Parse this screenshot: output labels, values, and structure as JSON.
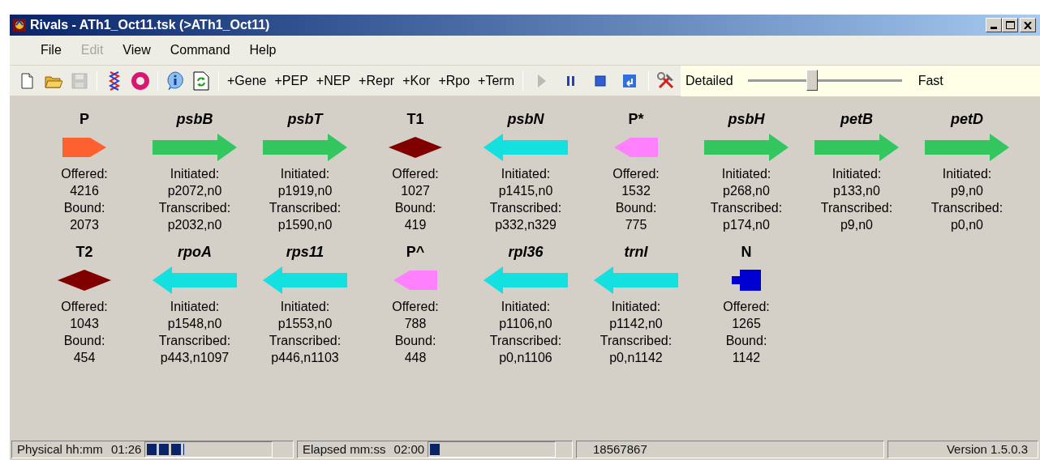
{
  "window": {
    "title": "Rivals - ATh1_Oct11.tsk (>ATh1_Oct11)"
  },
  "menu": [
    {
      "label": "File",
      "disabled": false
    },
    {
      "label": "Edit",
      "disabled": true
    },
    {
      "label": "View",
      "disabled": false
    },
    {
      "label": "Command",
      "disabled": false
    },
    {
      "label": "Help",
      "disabled": false
    }
  ],
  "toolbar": {
    "file_tools": [
      {
        "kind": "new",
        "disabled": false
      },
      {
        "kind": "open",
        "disabled": false
      },
      {
        "kind": "save",
        "disabled": true
      }
    ],
    "add_buttons": [
      "+Gene",
      "+PEP",
      "+NEP",
      "+Repr",
      "+Kor",
      "+Rpo",
      "+Term"
    ],
    "run_tools": [
      {
        "kind": "play",
        "disabled": true
      },
      {
        "kind": "pause",
        "disabled": false
      },
      {
        "kind": "stop",
        "disabled": false
      },
      {
        "kind": "back",
        "disabled": false
      }
    ],
    "speed": {
      "left_label": "Detailed",
      "right_label": "Fast",
      "level": 0.41
    }
  },
  "rows": [
    [
      {
        "name": "P",
        "kind": "promoter-right",
        "color": "#ff6030",
        "lines": [
          "Offered:",
          "4216",
          "Bound:",
          "2073"
        ]
      },
      {
        "name": "psbB",
        "kind": "gene-right",
        "color": "#33c65f",
        "lines": [
          "Initiated:",
          "p2072,n0",
          "Transcribed:",
          "p2032,n0"
        ]
      },
      {
        "name": "psbT",
        "kind": "gene-right",
        "color": "#33c65f",
        "lines": [
          "Initiated:",
          "p1919,n0",
          "Transcribed:",
          "p1590,n0"
        ]
      },
      {
        "name": "T1",
        "kind": "terminator",
        "color": "#800000",
        "lines": [
          "Offered:",
          "1027",
          "Bound:",
          "419"
        ]
      },
      {
        "name": "psbN",
        "kind": "gene-left",
        "color": "#14e0e0",
        "lines": [
          "Initiated:",
          "p1415,n0",
          "Transcribed:",
          "p332,n329"
        ]
      },
      {
        "name": "P*",
        "kind": "promoter-left",
        "color": "#ff80ff",
        "lines": [
          "Offered:",
          "1532",
          "Bound:",
          "775"
        ]
      },
      {
        "name": "psbH",
        "kind": "gene-right",
        "color": "#33c65f",
        "lines": [
          "Initiated:",
          "p268,n0",
          "Transcribed:",
          "p174,n0"
        ]
      },
      {
        "name": "petB",
        "kind": "gene-right",
        "color": "#33c65f",
        "lines": [
          "Initiated:",
          "p133,n0",
          "Transcribed:",
          "p9,n0"
        ]
      },
      {
        "name": "petD",
        "kind": "gene-right",
        "color": "#33c65f",
        "lines": [
          "Initiated:",
          "p9,n0",
          "Transcribed:",
          "p0,n0"
        ]
      }
    ],
    [
      {
        "name": "T2",
        "kind": "terminator",
        "color": "#800000",
        "lines": [
          "Offered:",
          "1043",
          "Bound:",
          "454"
        ]
      },
      {
        "name": "rpoA",
        "kind": "gene-left",
        "color": "#14e0e0",
        "lines": [
          "Initiated:",
          "p1548,n0",
          "Transcribed:",
          "p443,n1097"
        ]
      },
      {
        "name": "rps11",
        "kind": "gene-left",
        "color": "#14e0e0",
        "lines": [
          "Initiated:",
          "p1553,n0",
          "Transcribed:",
          "p446,n1103"
        ]
      },
      {
        "name": "P^",
        "kind": "promoter-left",
        "color": "#ff80ff",
        "lines": [
          "Offered:",
          "788",
          "Bound:",
          "448"
        ]
      },
      {
        "name": "rpl36",
        "kind": "gene-left",
        "color": "#14e0e0",
        "lines": [
          "Initiated:",
          "p1106,n0",
          "Transcribed:",
          "p0,n1106"
        ]
      },
      {
        "name": "trnI",
        "kind": "gene-left",
        "color": "#14e0e0",
        "lines": [
          "Initiated:",
          "p1142,n0",
          "Transcribed:",
          "p0,n1142"
        ]
      },
      {
        "name": "N",
        "kind": "node",
        "color": "#0000d0",
        "lines": [
          "Offered:",
          "1265",
          "Bound:",
          "1142"
        ]
      }
    ]
  ],
  "status_bar": {
    "physical": {
      "label": "Physical hh:mm",
      "value": "01:26",
      "level": 0.3
    },
    "elapsed": {
      "label": "Elapsed mm:ss",
      "value": "02:00",
      "level": 0.08
    },
    "count": "18567867",
    "version": "Version 1.5.0.3"
  }
}
